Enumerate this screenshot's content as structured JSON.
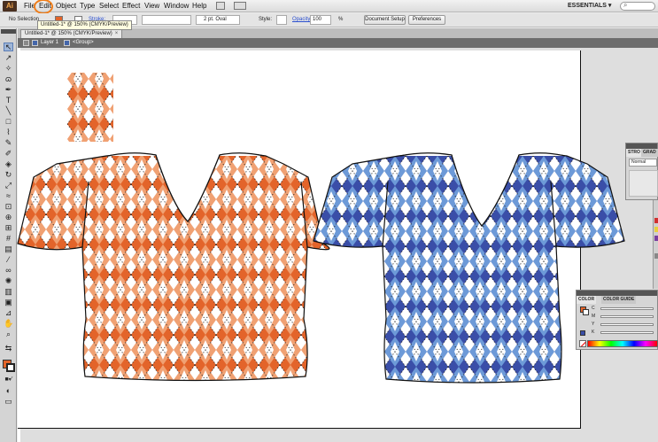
{
  "app": {
    "logo": "Ai"
  },
  "menu": {
    "items": [
      "File",
      "Edit",
      "Object",
      "Type",
      "Select",
      "Effect",
      "View",
      "Window",
      "Help"
    ],
    "highlighted": "Edit",
    "workspace": "ESSENTIALS ▾",
    "search_glyph": "⌕"
  },
  "controlbar": {
    "selection": "No Selection",
    "stroke_label": "Stroke:",
    "brush": "2 pt. Oval",
    "style_label": "Style:",
    "opacity_label": "Opacity:",
    "opacity_value": "100",
    "percent": "%",
    "document_setup": "Document Setup",
    "preferences": "Preferences"
  },
  "tooltip": "Untitled-1* @ 150% (CMYK/Preview)",
  "document": {
    "tab_title": "Untitled-1* @ 150% (CMYK/Preview)",
    "close": "×",
    "layer": "Layer 1",
    "group": "<Group>"
  },
  "panels": {
    "stroke": {
      "tabs": [
        "STROKE",
        "GRADIENT"
      ],
      "tab_short": [
        "STRO",
        "GRAD"
      ],
      "mode": "Normal"
    },
    "color": {
      "tabs": [
        "COLOR",
        "COLOR GUIDE"
      ],
      "tab_short": [
        "COLOR",
        "COLOR GUIDE"
      ],
      "channels": [
        "C",
        "M",
        "Y",
        "K"
      ]
    }
  },
  "colors": {
    "orange_dark": "#e3642a",
    "orange_light": "#f0a173",
    "blue_dark": "#3a4ea8",
    "blue_light": "#6d9ad8",
    "highlight_ring": "#ef7d1a"
  }
}
